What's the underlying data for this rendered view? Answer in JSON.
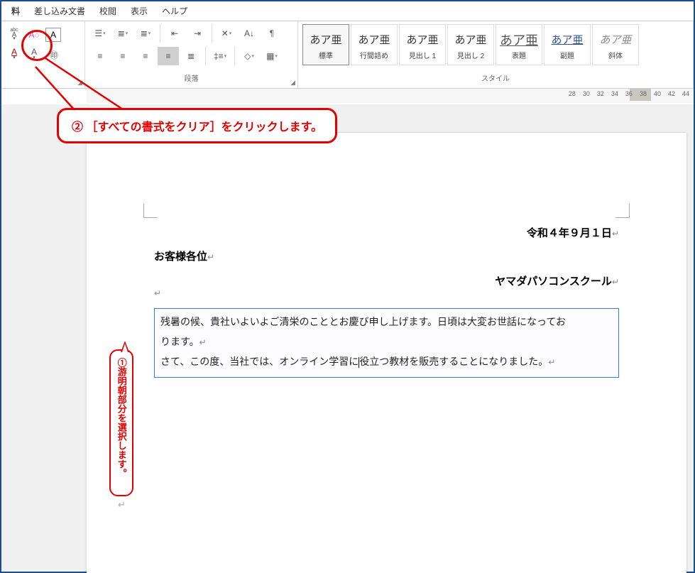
{
  "tabs": {
    "partial": "料",
    "items": [
      "差し込み文書",
      "校閲",
      "表示",
      "ヘルプ"
    ]
  },
  "ribbon": {
    "font": {
      "char_box": "A",
      "label": ""
    },
    "para": {
      "label": "段落"
    },
    "styles": {
      "label": "スタイル",
      "items": [
        {
          "sample": "あア亜",
          "name": "標準",
          "cls": "",
          "sel": true
        },
        {
          "sample": "あア亜",
          "name": "行間詰め",
          "cls": "",
          "sel": false
        },
        {
          "sample": "あア亜",
          "name": "見出し 1",
          "cls": "mincho",
          "sel": false
        },
        {
          "sample": "あア亜",
          "name": "見出し 2",
          "cls": "mincho",
          "sel": false
        },
        {
          "sample": "あア亜",
          "name": "表題",
          "cls": "mincho ul",
          "sel": false
        },
        {
          "sample": "あア亜",
          "name": "副題",
          "cls": "blueul",
          "sel": false
        },
        {
          "sample": "あア亜",
          "name": "斜体",
          "cls": "italic",
          "sel": false
        }
      ]
    }
  },
  "ruler_ticks": [
    "28",
    "30",
    "32",
    "34",
    "36",
    "38",
    "40",
    "42",
    "44"
  ],
  "document": {
    "date": "令和４年９月１日",
    "addressee": "お客様各位",
    "school": "ヤマダパソコンスクール",
    "body_l1": "残暑の候、貴社いよいよご清栄のこととお慶び申し上げます。日頃は大変お世話になってお",
    "body_l2": "ります。",
    "body_l3a": "さて、この度、当社では、オンライン学習に",
    "body_l3b": "役立つ教材を販売することになりました。"
  },
  "annotations": {
    "main": "② ［すべての書式をクリア］をクリックします。",
    "side": "①游明朝部分を選択します。"
  }
}
